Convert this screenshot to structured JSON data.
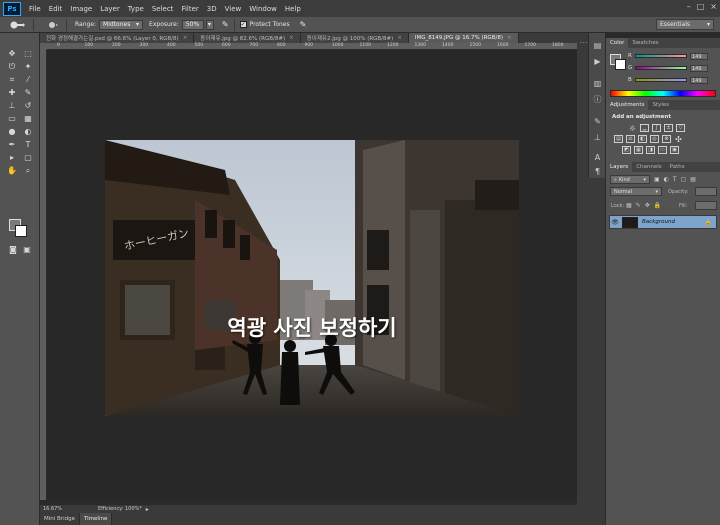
{
  "menubar": {
    "logo": "Ps",
    "items": [
      "File",
      "Edit",
      "Image",
      "Layer",
      "Type",
      "Select",
      "Filter",
      "3D",
      "View",
      "Window",
      "Help"
    ],
    "controls": [
      "–",
      "□",
      "×"
    ]
  },
  "options": {
    "range_label": "Range:",
    "range_value": "Midtones",
    "exposure_label": "Exposure:",
    "exposure_value": "50%",
    "protect_tones": "Protect Tones",
    "workspace": "Essentials"
  },
  "tabs": [
    {
      "label": "전화 경정해결가는길.psd @ 66.6% (Layer 0, RGB/8)",
      "active": false
    },
    {
      "label": "동이재유.jpg @ 82.6% (RGB/8#)",
      "active": false
    },
    {
      "label": "동이재유2.jpg @ 100% (RGB/8#)",
      "active": false
    },
    {
      "label": "IMG_8149.JPG @ 16.7% (RGB/8)",
      "active": true
    }
  ],
  "ruler_top": [
    "0",
    "100",
    "200",
    "300",
    "400",
    "500",
    "600",
    "700",
    "800",
    "900",
    "1000",
    "1100",
    "1200",
    "1300",
    "1400",
    "1500",
    "1600",
    "1700",
    "1800",
    "1900"
  ],
  "image": {
    "title": "역광 사진 보정하기",
    "sign_text": "ホーヒーガン"
  },
  "status": {
    "zoom": "16.67%",
    "efficiency": "Efficiency: 100%*"
  },
  "bottom_tabs": [
    "Mini Bridge",
    "Timeline"
  ],
  "color_panel": {
    "tabs": [
      "Color",
      "Swatches"
    ],
    "channels": [
      {
        "name": "R",
        "value": "149",
        "color": "#7a7a7a"
      },
      {
        "name": "G",
        "value": "149",
        "color": "#7a7a7a"
      },
      {
        "name": "B",
        "value": "149",
        "color": "#7a7a7a"
      }
    ]
  },
  "adjustments_panel": {
    "tabs": [
      "Adjustments",
      "Styles"
    ],
    "title": "Add an adjustment"
  },
  "layers_panel": {
    "tabs": [
      "Layers",
      "Channels",
      "Paths"
    ],
    "kind": "Kind",
    "blend": "Normal",
    "opacity_label": "Opacity:",
    "lock_label": "Lock:",
    "fill_label": "Fill:",
    "layer_name": "Background"
  },
  "colors": {
    "panel_bg": "#535353",
    "canvas_bg": "#282828",
    "selected_layer": "#7ea4cc",
    "ps_blue": "#31a8ff"
  }
}
